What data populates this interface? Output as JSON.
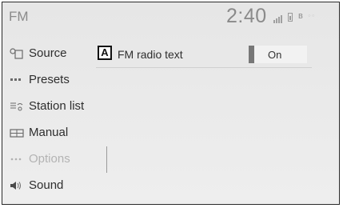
{
  "header": {
    "title": "FM",
    "clock": "2:40"
  },
  "status": {
    "signal_icon": "signal-bars-icon",
    "battery_icon": "battery-icon",
    "bluetooth_icon": "bluetooth-icon"
  },
  "sidebar": {
    "items": [
      {
        "label": "Source",
        "icon": "source-icon"
      },
      {
        "label": "Presets",
        "icon": "presets-icon"
      },
      {
        "label": "Station list",
        "icon": "station-list-icon"
      },
      {
        "label": "Manual",
        "icon": "manual-icon"
      },
      {
        "label": "Options",
        "icon": "options-icon",
        "active": true
      },
      {
        "label": "Sound",
        "icon": "speaker-icon"
      }
    ]
  },
  "main": {
    "option": {
      "badge": "A",
      "label": "FM radio text",
      "value": "On"
    }
  }
}
